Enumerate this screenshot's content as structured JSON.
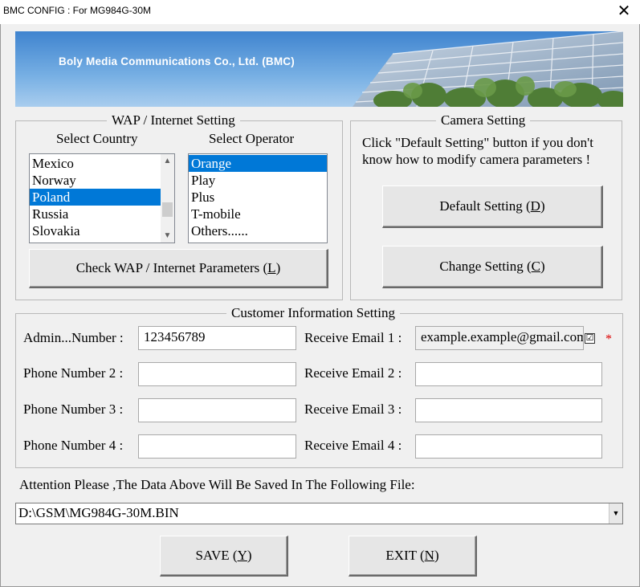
{
  "window": {
    "title": "BMC CONFIG : For MG984G-30M",
    "close_glyph": "✕"
  },
  "banner": {
    "company": "Boly Media Communications Co., Ltd. (BMC)"
  },
  "wap": {
    "legend": "WAP / Internet Setting",
    "country_label": "Select Country",
    "operator_label": "Select Operator",
    "countries": [
      "Mexico",
      "Norway",
      "Poland",
      "Russia",
      "Slovakia"
    ],
    "selected_country": "Poland",
    "operators": [
      "Orange",
      "Play",
      "Plus",
      "T-mobile",
      "Others......"
    ],
    "selected_operator": "Orange",
    "check_button": {
      "pre": "Check WAP / Internet Parameters (",
      "key": "L",
      "post": ")"
    }
  },
  "camera": {
    "legend": "Camera Setting",
    "hint_line1": "Click \"Default Setting\" button if you don't",
    "hint_line2": "know how to modify camera parameters !",
    "default_button": {
      "pre": "Default Setting (",
      "key": "D",
      "post": ")"
    },
    "change_button": {
      "pre": "Change Setting (",
      "key": "C",
      "post": ")"
    }
  },
  "customer": {
    "legend": "Customer Information Setting",
    "rows": [
      {
        "phone_label": "Admin...Number :",
        "phone_value": "123456789",
        "email_label": "Receive Email 1 :",
        "email_value": "example.example@gmail.com"
      },
      {
        "phone_label": "Phone Number 2 :",
        "phone_value": "",
        "email_label": "Receive Email 2 :",
        "email_value": ""
      },
      {
        "phone_label": "Phone Number 3 :",
        "phone_value": "",
        "email_label": "Receive Email 3 :",
        "email_value": ""
      },
      {
        "phone_label": "Phone Number 4 :",
        "phone_value": "",
        "email_label": "Receive Email 4 :",
        "email_value": ""
      }
    ],
    "email1_checked": "☑",
    "required_mark": "*"
  },
  "file": {
    "attention": "Attention Please ,The Data Above Will Be Saved In The Following  File:",
    "path": "D:\\GSM\\MG984G-30M.BIN"
  },
  "actions": {
    "save": {
      "pre": "SAVE (",
      "key": "Y",
      "post": ")"
    },
    "exit": {
      "pre": "EXIT (",
      "key": "N",
      "post": ")"
    }
  },
  "colors": {
    "selection": "#0078d7",
    "window_bg": "#f0f0f0",
    "required": "#dd0000"
  }
}
